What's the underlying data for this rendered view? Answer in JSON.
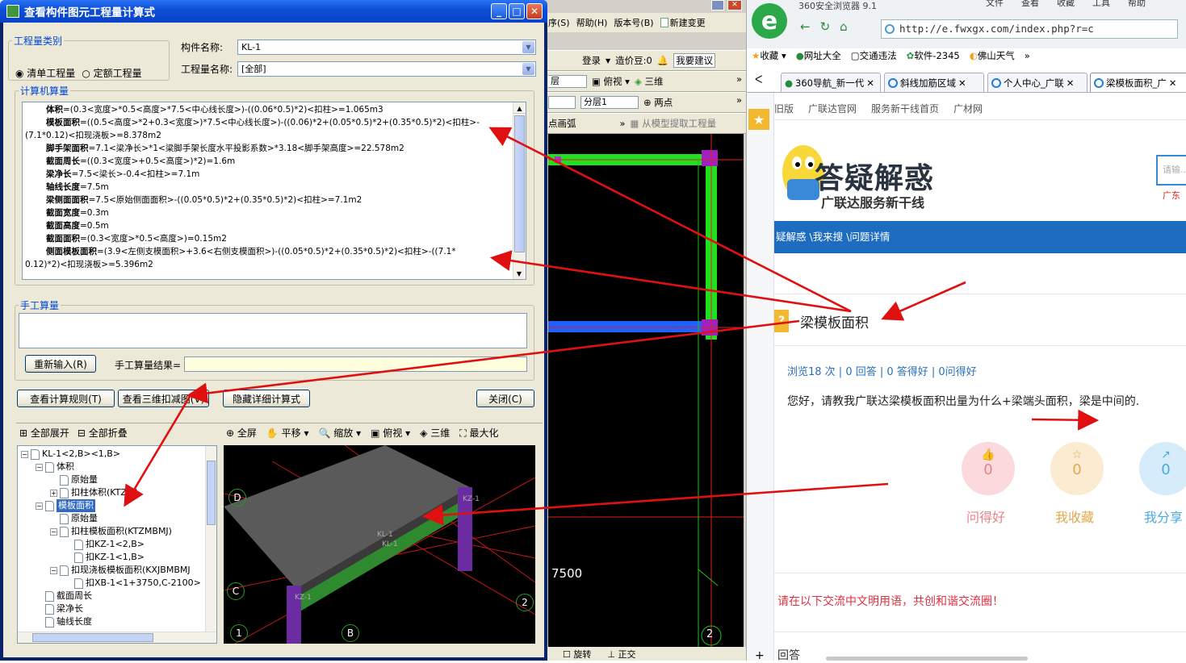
{
  "dialog": {
    "title": "查看构件图元工程量计算式",
    "qty_category_legend": "工程量类别",
    "radio_list": "清单工程量",
    "radio_quota": "定额工程量",
    "component_name_label": "构件名称:",
    "component_name_value": "KL-1",
    "qty_name_label": "工程量名称:",
    "qty_name_value": "[全部]",
    "computer_calc_legend": "计算机算量",
    "calc_lines": [
      {
        "bold": "体积",
        "text": "=(0.3<宽度>*0.5<高度>*7.5<中心线长度>)-((0.06*0.5)*2)<扣柱>=1.065m3",
        "indent": 1
      },
      {
        "bold": "模板面积",
        "text": "=((0.5<高度>*2+0.3<宽度>)*7.5<中心线长度>)-((0.06)*2+(0.05*0.5)*2+(0.35*0.5)*2)<扣柱>-",
        "indent": 1
      },
      {
        "bold": "",
        "text": "(7.1*0.12)<扣现浇板>=8.378m2",
        "indent": 0
      },
      {
        "bold": "脚手架面积",
        "text": "=7.1<梁净长>*1<梁脚手架长度水平投影系数>*3.18<脚手架高度>=22.578m2",
        "indent": 1
      },
      {
        "bold": "截面周长",
        "text": "=((0.3<宽度>+0.5<高度>)*2)=1.6m",
        "indent": 1
      },
      {
        "bold": "梁净长",
        "text": "=7.5<梁长>-0.4<扣柱>=7.1m",
        "indent": 1
      },
      {
        "bold": "轴线长度",
        "text": "=7.5m",
        "indent": 1
      },
      {
        "bold": "梁侧面面积",
        "text": "=7.5<原始侧面面积>-((0.05*0.5)*2+(0.35*0.5)*2)<扣柱>=7.1m2",
        "indent": 1
      },
      {
        "bold": "截面宽度",
        "text": "=0.3m",
        "indent": 1
      },
      {
        "bold": "截面高度",
        "text": "=0.5m",
        "indent": 1
      },
      {
        "bold": "截面面积",
        "text": "=(0.3<宽度>*0.5<高度>)=0.15m2",
        "indent": 1
      },
      {
        "bold": "侧面模板面积",
        "text": "=(3.9<左侧支模面积>+3.6<右侧支模面积>)-((0.05*0.5)*2+(0.35*0.5)*2)<扣柱>-((7.1*",
        "indent": 1
      },
      {
        "bold": "",
        "text": "0.12)*2)<扣现浇板>=5.396m2",
        "indent": 0
      }
    ],
    "manual_legend": "手工算量",
    "reinput_button": "重新输入(R)",
    "manual_result_label": "手工算量结果=",
    "manual_result_value": "",
    "view_rules_button": "查看计算规则(T)",
    "view_3d_button": "查看三维扣减图(V)",
    "hide_detail_button": "隐藏详细计算式",
    "close_button": "关闭(C)",
    "expand_all": "全部展开",
    "collapse_all": "全部折叠",
    "tree": [
      {
        "label": "KL-1<2,B><1,B>",
        "level": 0,
        "exp": "−"
      },
      {
        "label": "体积",
        "level": 1,
        "exp": "−"
      },
      {
        "label": "原始量",
        "level": 2,
        "exp": ""
      },
      {
        "label": "扣柱体积(KTZTJ)",
        "level": 2,
        "exp": "+"
      },
      {
        "label": "模板面积",
        "level": 1,
        "exp": "−",
        "selected": true
      },
      {
        "label": "原始量",
        "level": 2,
        "exp": ""
      },
      {
        "label": "扣柱模板面积(KTZMBMJ)",
        "level": 2,
        "exp": "−"
      },
      {
        "label": "扣KZ-1<2,B>",
        "level": 3,
        "exp": ""
      },
      {
        "label": "扣KZ-1<1,B>",
        "level": 3,
        "exp": ""
      },
      {
        "label": "扣现浇板模板面积(KXJBMBMJ",
        "level": 2,
        "exp": "−"
      },
      {
        "label": "扣XB-1<1+3750,C-2100>",
        "level": 3,
        "exp": ""
      },
      {
        "label": "截面周长",
        "level": 1,
        "exp": ""
      },
      {
        "label": "梁净长",
        "level": 1,
        "exp": ""
      },
      {
        "label": "轴线长度",
        "level": 1,
        "exp": ""
      }
    ],
    "view_toolbar": [
      "全屏",
      "平移",
      "缩放",
      "俯视",
      "三维",
      "最大化"
    ],
    "view3d_labels": {
      "d": "D",
      "c": "C",
      "b": "B",
      "one": "1",
      "two": "2",
      "kz1a": "KZ-1",
      "kz1b": "KZ-1",
      "kl1a": "KL-1",
      "kl1b": "KL-1"
    }
  },
  "cad": {
    "menu": [
      "帮助(H)",
      "版本号(B)",
      "新建变更"
    ],
    "menu_prefix": "序(S)",
    "toolbar1": [
      "登录",
      "造价豆:0",
      "我要建议"
    ],
    "toolbar2": [
      "层",
      "俯视",
      "三维"
    ],
    "toolbar3_floor": "分层1",
    "toolbar3_btn": "两点",
    "toolbar4_left": "点画弧",
    "toolbar4_btn": "从模型提取工程量",
    "dim_7500": "7500",
    "axis_2": "2",
    "bottom": [
      "旋转",
      "正交"
    ]
  },
  "browser": {
    "app_title": "360安全浏览器 9.1",
    "menu": [
      "文件",
      "查看",
      "收藏",
      "工具",
      "帮助"
    ],
    "url": "http://e.fwxgx.com/index.php?r=c",
    "bookmarks": [
      "收藏",
      "网址大全",
      "交通违法",
      "软件-2345",
      "佛山天气"
    ],
    "tabs": [
      "360导航_新一代",
      "斜线加筋区域",
      "个人中心_广联",
      "梁模板面积_广"
    ],
    "subnav": [
      "旧版",
      "广联达官网",
      "服务新干线首页",
      "广材网"
    ],
    "site_title": "答疑解惑",
    "site_sub": "广联达服务新干线",
    "search_placeholder": "请输...",
    "search_hint": "广东",
    "breadcrumb": "疑解惑 \\我来搜 \\问题详情",
    "question_title": "梁模板面积",
    "stats": "浏览18 次 | 0 回答 | 0 答得好 | 0问得好",
    "question_text": "您好，请教我广联达梁模板面积出量为什么+梁端头面积，梁是中间的.",
    "actions": [
      {
        "label": "问得好",
        "count": "0",
        "color": "#e8838a",
        "bg": "#fbd9dc"
      },
      {
        "label": "我收藏",
        "count": "0",
        "color": "#e0a850",
        "bg": "#fbebd0"
      },
      {
        "label": "我分享",
        "count": "0",
        "color": "#4aa8e0",
        "bg": "#d6ecfa"
      }
    ],
    "notice": "请在以下交流中文明用语，共创和谐交流圈！",
    "answer_head": "回答",
    "fav_star": "★"
  }
}
